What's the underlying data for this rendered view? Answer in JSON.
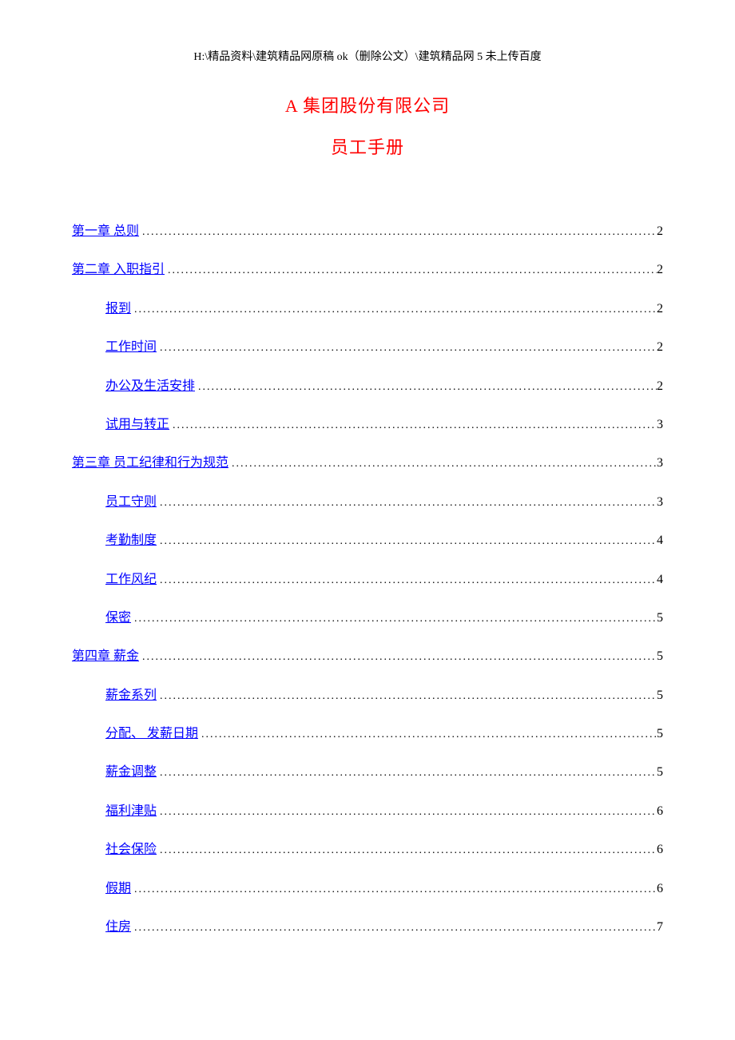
{
  "header_path": "H:\\精品资料\\建筑精品网原稿 ok（删除公文）\\建筑精品网 5 未上传百度",
  "title_line1": "A 集团股份有限公司",
  "title_line2": "员工手册",
  "toc": [
    {
      "level": 1,
      "label": "第一章  总则",
      "page": "2"
    },
    {
      "level": 1,
      "label": "第二章  入职指引",
      "page": "2"
    },
    {
      "level": 2,
      "label": "报到",
      "page": "2"
    },
    {
      "level": 2,
      "label": "工作时间",
      "page": "2"
    },
    {
      "level": 2,
      "label": "办公及生活安排",
      "page": "2"
    },
    {
      "level": 2,
      "label": "试用与转正",
      "page": "3"
    },
    {
      "level": 1,
      "label": "第三章  员工纪律和行为规范",
      "page": "3"
    },
    {
      "level": 2,
      "label": "员工守则",
      "page": "3"
    },
    {
      "level": 2,
      "label": "考勤制度",
      "page": "4"
    },
    {
      "level": 2,
      "label": "工作风纪",
      "page": "4"
    },
    {
      "level": 2,
      "label": "保密",
      "page": "5"
    },
    {
      "level": 1,
      "label": "第四章  薪金",
      "page": "5"
    },
    {
      "level": 2,
      "label": "薪金系列",
      "page": "5"
    },
    {
      "level": 2,
      "label": "分配、 发薪日期",
      "page": "5"
    },
    {
      "level": 2,
      "label": "薪金调整",
      "page": "5"
    },
    {
      "level": 2,
      "label": "福利津贴",
      "page": "6"
    },
    {
      "level": 2,
      "label": "社会保险",
      "page": "6"
    },
    {
      "level": 2,
      "label": "假期",
      "page": "6"
    },
    {
      "level": 2,
      "label": "住房",
      "page": "7"
    }
  ]
}
